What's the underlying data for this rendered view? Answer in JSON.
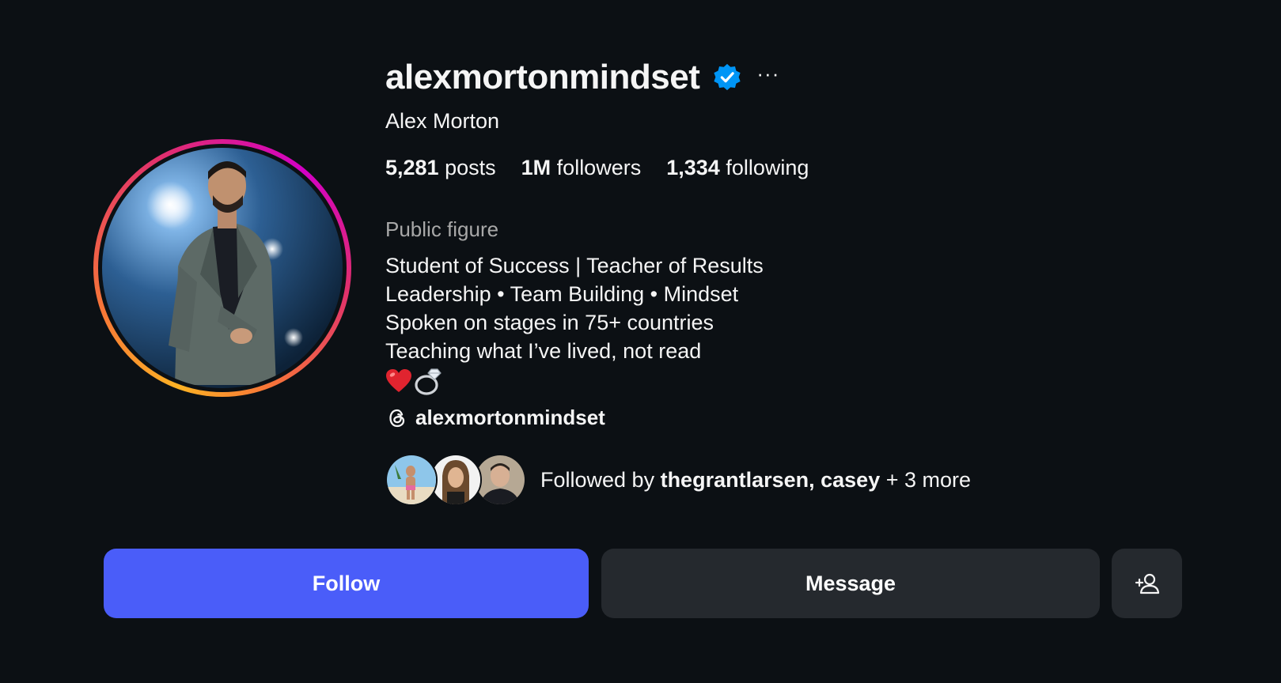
{
  "profile": {
    "username": "alexmortonmindset",
    "full_name": "Alex Morton",
    "category": "Public figure",
    "verified": true,
    "stats": {
      "posts_count": "5,281",
      "posts_label": "posts",
      "followers_count": "1M",
      "followers_label": "followers",
      "following_count": "1,334",
      "following_label": "following"
    },
    "bio": [
      "Student of Success | Teacher of Results",
      "Leadership • Team Building • Mindset",
      "Spoken on stages in 75+ countries",
      "Teaching what I’ve lived, not read"
    ],
    "bio_emojis": [
      "heart-icon",
      "ring-icon"
    ],
    "threads_handle": "alexmortonmindset",
    "followed_by": {
      "prefix": "Followed by ",
      "names": "thegrantlarsen, casey",
      "suffix": " + 3 more"
    }
  },
  "actions": {
    "follow_label": "Follow",
    "message_label": "Message",
    "suggest_icon": "add-person-icon"
  },
  "colors": {
    "background": "#0c1014",
    "follow_button": "#4a5df9",
    "secondary_button": "#25292e",
    "verified_badge": "#0095f6",
    "muted_text": "#a8a8a8"
  }
}
